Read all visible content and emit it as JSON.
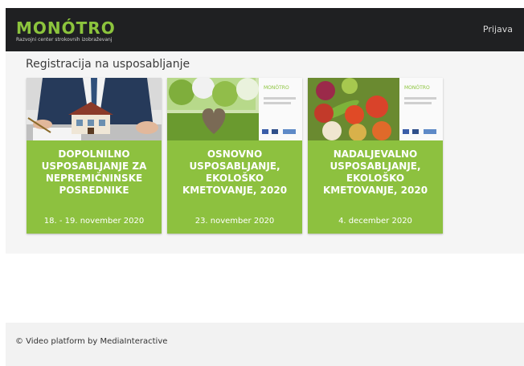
{
  "header": {
    "logo_text": "MONÓTRO",
    "logo_tagline": "Razvojni center strokovnih izobraževanj",
    "login_label": "Prijava"
  },
  "main": {
    "section_title": "Registracija na usposabljanje",
    "cards": [
      {
        "title": "DOPOLNILNO USPOSABLJANJE ZA NEPREMIČNINSKE POSREDNIKE",
        "date": "18. - 19. november 2020",
        "image_icon": "house-model-with-businessman-icon"
      },
      {
        "title": "OSNOVNO USPOSABLJANJE, EKOLOŠKO KMETOVANJE, 2020",
        "date": "23. november 2020",
        "image_icon": "heart-in-orchard-icon"
      },
      {
        "title": "NADALJEVALNO USPOSABLJANJE, EKOLOŠKO KMETOVANJE, 2020",
        "date": "4. december 2020",
        "image_icon": "vegetables-basket-icon"
      }
    ]
  },
  "footer": {
    "text": "© Video platform by MediaInteractive"
  },
  "colors": {
    "header_bg": "#1f2022",
    "brand_green": "#8cc43d",
    "card_green": "#8dc13f",
    "content_bg": "#f5f5f5"
  }
}
